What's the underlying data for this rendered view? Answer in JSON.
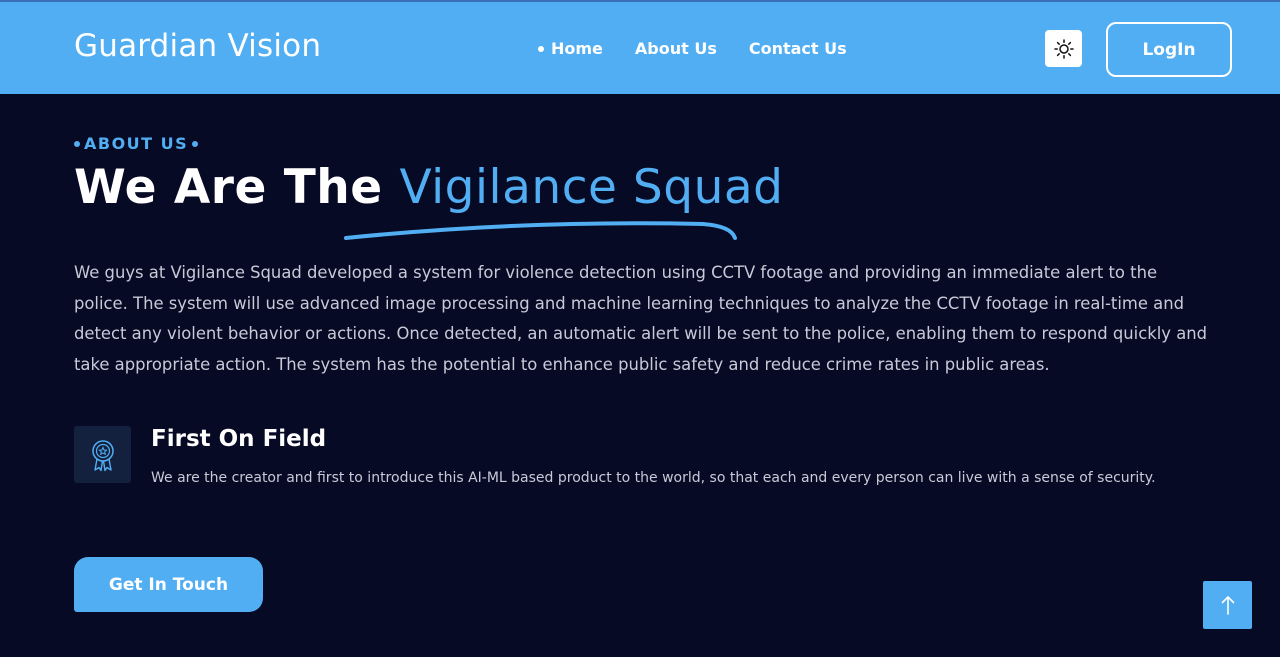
{
  "header": {
    "brand": "Guardian Vision",
    "nav": [
      {
        "label": "Home",
        "active": true
      },
      {
        "label": "About Us",
        "active": false
      },
      {
        "label": "Contact Us",
        "active": false
      }
    ],
    "theme_icon": "sun-icon",
    "login_label": "LogIn"
  },
  "about": {
    "eyebrow": "ABOUT US",
    "headline_prefix": "We Are The",
    "headline_accent": "Vigilance Squad",
    "description": "We guys at Vigilance Squad developed a system for violence detection using CCTV footage and providing an immediate alert to the police. The system will use advanced image processing and machine learning techniques to analyze the CCTV footage in real-time and detect any violent behavior or actions. Once detected, an automatic alert will be sent to the police, enabling them to respond quickly and take appropriate action. The system has the potential to enhance public safety and reduce crime rates in public areas.",
    "feature": {
      "icon": "award-badge-icon",
      "title": "First On Field",
      "text": "We are the creator and first to introduce this AI-ML based product to the world, so that each and every person can live with a sense of security."
    },
    "cta_label": "Get In Touch"
  },
  "scroll_top_icon": "arrow-up-icon",
  "colors": {
    "header_bg": "#52aef2",
    "page_bg": "#070a24",
    "accent": "#52aef2",
    "text_muted": "#c7cad8"
  }
}
